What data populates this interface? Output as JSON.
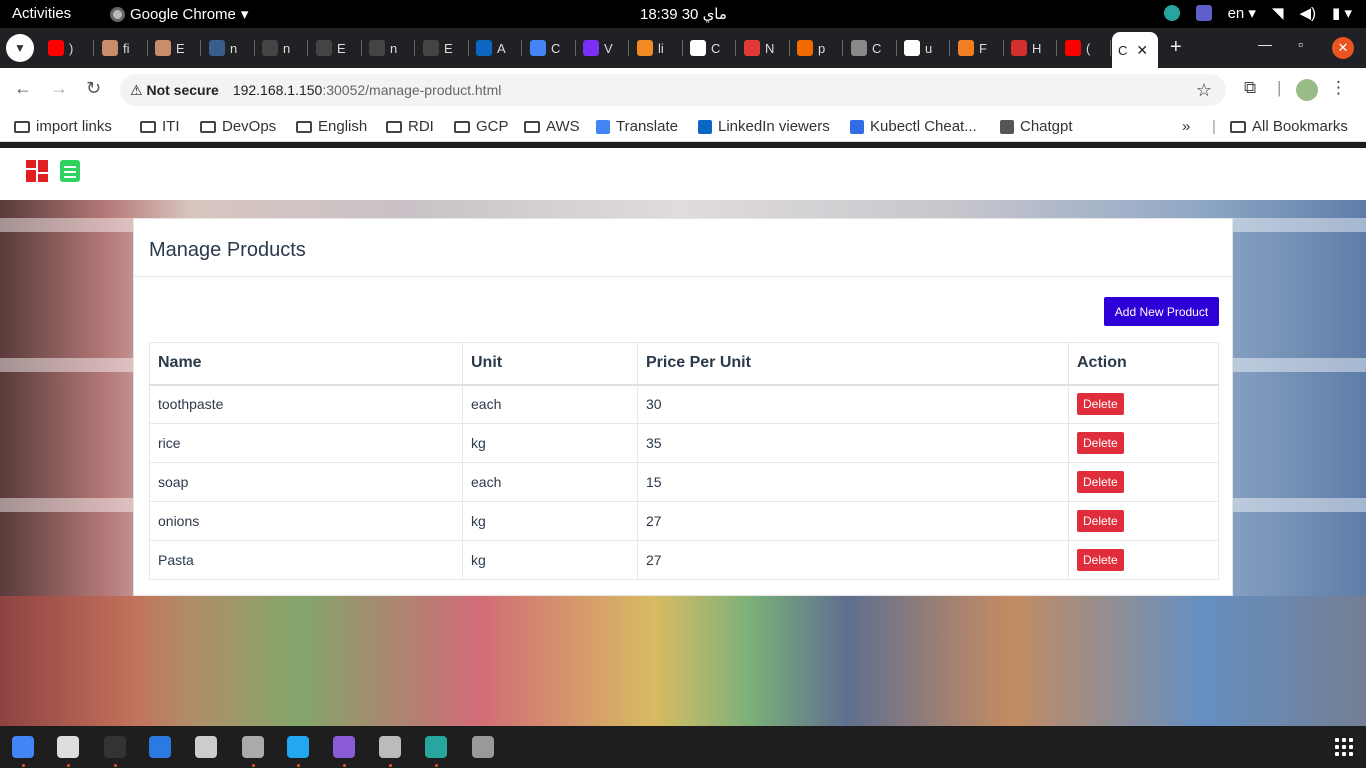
{
  "system_bar": {
    "activities": "Activities",
    "app_name": "Google Chrome",
    "clock": "18:39  30 ماي",
    "language": "en"
  },
  "browser": {
    "address_warning": "Not secure",
    "url_host": "192.168.1.150",
    "url_path": ":30052/manage-product.html",
    "tabs": [
      {
        "label": ")",
        "icon": "youtube-icon",
        "color": "#ff0000"
      },
      {
        "label": "fi",
        "icon": "avatar-icon",
        "color": "#c98d6a"
      },
      {
        "label": "E",
        "icon": "avatar-icon",
        "color": "#c98d6a"
      },
      {
        "label": "n",
        "icon": "globe-icon",
        "color": "#3b5e8c"
      },
      {
        "label": "n",
        "icon": "github-icon",
        "color": "#444444"
      },
      {
        "label": "E",
        "icon": "github-icon",
        "color": "#444444"
      },
      {
        "label": "n",
        "icon": "github-icon",
        "color": "#444444"
      },
      {
        "label": "E",
        "icon": "github-icon",
        "color": "#444444"
      },
      {
        "label": "A",
        "icon": "linkedin-icon",
        "color": "#0a66c2"
      },
      {
        "label": "C",
        "icon": "translate-icon",
        "color": "#4285f4"
      },
      {
        "label": "V",
        "icon": "cube-icon",
        "color": "#7b2ff7"
      },
      {
        "label": "li",
        "icon": "orange-icon",
        "color": "#f08a24"
      },
      {
        "label": "C",
        "icon": "chatgpt-icon",
        "color": "#ffffff"
      },
      {
        "label": "N",
        "icon": "red-m-icon",
        "color": "#e53935"
      },
      {
        "label": "p",
        "icon": "x-icon",
        "color": "#f06a00"
      },
      {
        "label": "C",
        "icon": "grey-circle-icon",
        "color": "#888888"
      },
      {
        "label": "u",
        "icon": "google-icon",
        "color": "#ffffff"
      },
      {
        "label": "F",
        "icon": "stack-icon",
        "color": "#f48024"
      },
      {
        "label": "H",
        "icon": "hub-icon",
        "color": "#d32f2f"
      },
      {
        "label": "(",
        "icon": "youtube-icon",
        "color": "#ff0000"
      }
    ],
    "active_tab_label": "C"
  },
  "bookmarks": [
    {
      "label": "import links",
      "type": "folder"
    },
    {
      "label": "ITI",
      "type": "folder"
    },
    {
      "label": "DevOps",
      "type": "folder"
    },
    {
      "label": "English",
      "type": "folder"
    },
    {
      "label": "RDI",
      "type": "folder"
    },
    {
      "label": "GCP",
      "type": "folder"
    },
    {
      "label": "AWS",
      "type": "folder"
    },
    {
      "label": "Translate",
      "type": "link",
      "icon": "translate-icon",
      "color": "#4285f4"
    },
    {
      "label": "LinkedIn viewers",
      "type": "link",
      "icon": "linkedin-icon",
      "color": "#0a66c2"
    },
    {
      "label": "Kubectl Cheat...",
      "type": "link",
      "icon": "kubernetes-icon",
      "color": "#326ce5"
    },
    {
      "label": "Chatgpt",
      "type": "link",
      "icon": "chatgpt-icon",
      "color": "#555555"
    }
  ],
  "bookmarks_all": "All Bookmarks",
  "page": {
    "title": "Manage Products",
    "add_button": "Add New Product",
    "columns": [
      "Name",
      "Unit",
      "Price Per Unit",
      "Action"
    ],
    "rows": [
      {
        "name": "toothpaste",
        "unit": "each",
        "price": "30",
        "action": "Delete"
      },
      {
        "name": "rice",
        "unit": "kg",
        "price": "35",
        "action": "Delete"
      },
      {
        "name": "soap",
        "unit": "each",
        "price": "15",
        "action": "Delete"
      },
      {
        "name": "onions",
        "unit": "kg",
        "price": "27",
        "action": "Delete"
      },
      {
        "name": "Pasta",
        "unit": "kg",
        "price": "27",
        "action": "Delete"
      }
    ]
  },
  "colors": {
    "add_button": "#2c00d6",
    "delete_button": "#e02d3c",
    "logo_dashboard": "#e02020",
    "logo_clipboard": "#2fd25e"
  },
  "dock": [
    {
      "icon": "chrome-icon",
      "color": "#4285f4",
      "running": true
    },
    {
      "icon": "files-icon",
      "color": "#dddddd",
      "running": true
    },
    {
      "icon": "terminal-icon",
      "color": "#333333",
      "running": true
    },
    {
      "icon": "document-icon",
      "color": "#2a7ae2",
      "running": false
    },
    {
      "icon": "clipboard-icon",
      "color": "#cccccc",
      "running": false
    },
    {
      "icon": "settings-icon",
      "color": "#aaaaaa",
      "running": true
    },
    {
      "icon": "vscode-icon",
      "color": "#22a7f0",
      "running": true
    },
    {
      "icon": "media-icon",
      "color": "#8a5bd6",
      "running": true
    },
    {
      "icon": "screenshot-icon",
      "color": "#bbbbbb",
      "running": true
    },
    {
      "icon": "update-icon",
      "color": "#27a6a0",
      "running": true
    },
    {
      "icon": "ssd-icon",
      "color": "#999999",
      "running": false
    }
  ]
}
